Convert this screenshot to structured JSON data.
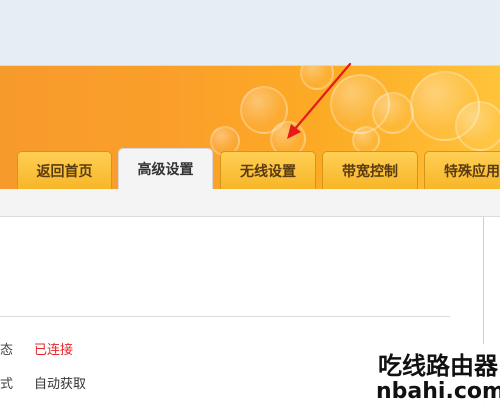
{
  "tabs": [
    {
      "label": "返回首页",
      "active": false
    },
    {
      "label": "高级设置",
      "active": true
    },
    {
      "label": "无线设置",
      "active": false
    },
    {
      "label": "带宽控制",
      "active": false
    },
    {
      "label": "特殊应用",
      "active": false
    }
  ],
  "status": {
    "connection_label": "态",
    "connection_value": "已连接",
    "mode_label": "式",
    "mode_value": "自动获取"
  },
  "watermark": {
    "cn": "吃线路由器",
    "en": "nbahi.com"
  },
  "colors": {
    "banner_orange": "#fb9f2a",
    "tab_yellow": "#ffc33a",
    "status_red": "#e8262a",
    "arrow_red": "#e51a1a"
  },
  "icons": {
    "annotation": "red-arrow-pointer"
  }
}
